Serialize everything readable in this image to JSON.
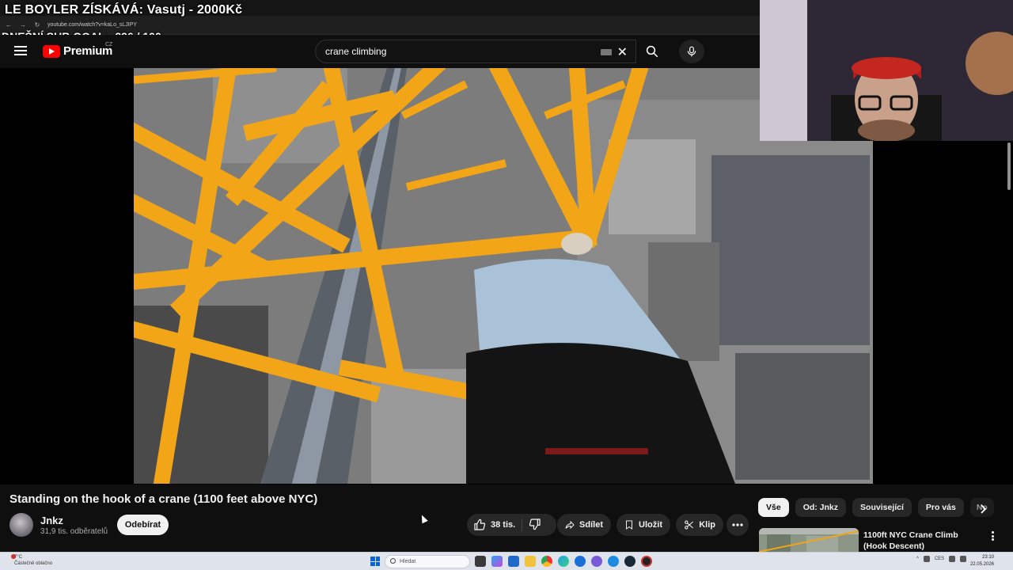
{
  "overlay": {
    "title": "LE BOYLER ZÍSKÁVÁ: Vasutj - 2000Kč",
    "goal_label": "DNEŠNÍ SUB GOAL:",
    "goal_value": "296 / 100"
  },
  "browser": {
    "url": "youtube.com/watch?v=kaLo_sLJIPY"
  },
  "header": {
    "logo_text": "Premium",
    "country": "CZ",
    "search_value": "crane climbing"
  },
  "video": {
    "title": "Standing on the hook of a crane (1100 feet above NYC)",
    "channel": "Jnkz",
    "subscribers": "31,9 tis. odběratelů",
    "subscribe_label": "Odebírat",
    "likes": "38 tis.",
    "share_label": "Sdílet",
    "save_label": "Uložit",
    "clip_label": "Klip"
  },
  "chips": [
    {
      "label": "Vše",
      "active": true
    },
    {
      "label": "Od: Jnkz"
    },
    {
      "label": "Související"
    },
    {
      "label": "Pro vás"
    },
    {
      "label": "No"
    }
  ],
  "recommendation": {
    "title": "1100ft NYC Crane Climb (Hook Descent)"
  },
  "taskbar": {
    "weather_temp": "7°C",
    "weather_text": "Částečně oblačno",
    "search_placeholder": "Hledat",
    "language": "CES",
    "time": "23:10",
    "date": "22.05.2026"
  },
  "colors": {
    "youtube_red": "#ff0000",
    "crane_yellow": "#f2a516",
    "background": "#0f0f0f"
  }
}
